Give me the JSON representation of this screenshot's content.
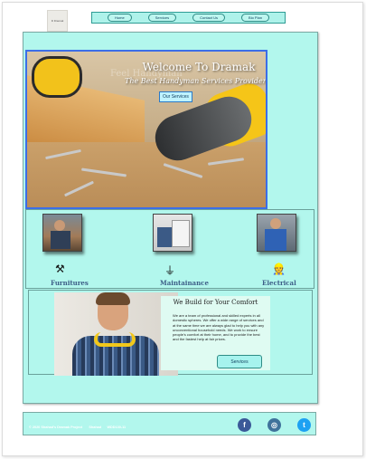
{
  "logo": {
    "text": "D Dramak"
  },
  "nav": {
    "items": [
      {
        "label": "Home"
      },
      {
        "label": "Services"
      },
      {
        "label": "Contact Us"
      },
      {
        "label": "Bio Plan"
      }
    ]
  },
  "hero": {
    "title": "Welcome To Dramak",
    "subtitle": "The Best Handyman Services Providers",
    "watermark": "Feel Handyman",
    "button_label": "Our Services"
  },
  "services": [
    {
      "label": "Furnitures",
      "icon": "tools-icon"
    },
    {
      "label": "Maintainance",
      "icon": "plug-icon"
    },
    {
      "label": "Electrical",
      "icon": "worker-icon"
    }
  ],
  "about": {
    "title": "We Build for Your Comfort",
    "text": "We are a team of professional and skilled experts in all domestic spheres. We offer a wide range of services and at the same time we are always glad to help you with any unconventional household needs. We work to ensure people's comfort at their home, and to provide the best and the fastest help at fair prices.",
    "button_label": "Services"
  },
  "footer": {
    "copyright": "© 2020 Shahad's Dramak Project",
    "name": "Shahad",
    "id": "WDD130-11"
  },
  "social": [
    {
      "icon": "facebook-icon",
      "glyph": "f",
      "color": "#3b5998"
    },
    {
      "icon": "instagram-icon",
      "glyph": "◎",
      "color": "#3f729b"
    },
    {
      "icon": "twitter-icon",
      "glyph": "t",
      "color": "#1da1f2"
    }
  ],
  "colors": {
    "panel": "#b2f7ed",
    "accent_border": "#3b6ee8"
  }
}
